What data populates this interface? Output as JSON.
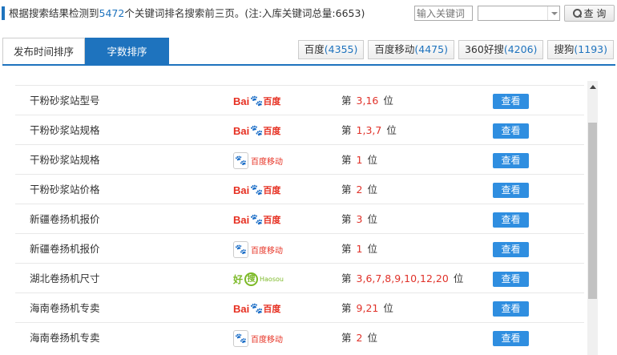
{
  "summary": {
    "prefix": "根据搜索结果检测到",
    "count": "5472",
    "suffix": "个关键词排名搜索前三页。(注:入库关键词总量:6653)"
  },
  "search": {
    "placeholder": "输入关键词",
    "button_label": "查 询"
  },
  "tabs": [
    {
      "label": "发布时间排序",
      "active": false
    },
    {
      "label": "字数排序",
      "active": true
    }
  ],
  "engines": [
    {
      "name": "百度",
      "count": "(4355)"
    },
    {
      "name": "百度移动",
      "count": "(4475)"
    },
    {
      "name": "360好搜",
      "count": "(4206)"
    },
    {
      "name": "搜狗",
      "count": "(1193)"
    }
  ],
  "logos": {
    "baidu": {
      "bai": "Bai",
      "paw": "🐾",
      "du": "百度"
    },
    "baidu_mobile": {
      "paw": "🐾",
      "text": "百度移动"
    },
    "haosou": {
      "hao": "好",
      "sou": "搜",
      "text": "Haosou"
    }
  },
  "rank_prefix": "第",
  "rank_suffix": "位",
  "view_label": "查看",
  "rows": [
    {
      "keyword": "干粉砂浆站型号",
      "engine": "baidu",
      "positions": "3,16"
    },
    {
      "keyword": "干粉砂浆站规格",
      "engine": "baidu",
      "positions": "1,3,7"
    },
    {
      "keyword": "干粉砂浆站规格",
      "engine": "baidu_mobile",
      "positions": "1"
    },
    {
      "keyword": "干粉砂浆站价格",
      "engine": "baidu",
      "positions": "2"
    },
    {
      "keyword": "新疆卷扬机报价",
      "engine": "baidu",
      "positions": "3"
    },
    {
      "keyword": "新疆卷扬机报价",
      "engine": "baidu_mobile",
      "positions": "1"
    },
    {
      "keyword": "湖北卷扬机尺寸",
      "engine": "haosou",
      "positions": "3,6,7,8,9,10,12,20"
    },
    {
      "keyword": "海南卷扬机专卖",
      "engine": "baidu",
      "positions": "9,21"
    },
    {
      "keyword": "海南卷扬机专卖",
      "engine": "baidu_mobile",
      "positions": "2"
    }
  ]
}
